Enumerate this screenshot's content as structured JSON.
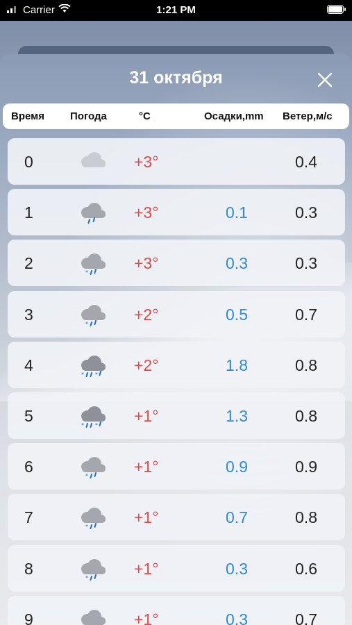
{
  "status_bar": {
    "carrier": "Carrier",
    "time": "1:21 PM",
    "icons": [
      "wifi-icon",
      "battery-icon"
    ]
  },
  "header": {
    "title": "31 октября",
    "close_icon": "close-icon"
  },
  "columns": {
    "time": "Время",
    "weather": "Погода",
    "temp": "°C",
    "precip": "Осадки,mm",
    "wind": "Ветер,м/с"
  },
  "colors": {
    "temp": "#e24a47",
    "precip": "#2e8bd6"
  },
  "rows": [
    {
      "hour": "0",
      "icon": "cloud-icon",
      "temp": "+3°",
      "precip": "",
      "wind": "0.4"
    },
    {
      "hour": "1",
      "icon": "cloud-rain-icon",
      "temp": "+3°",
      "precip": "0.1",
      "wind": "0.3"
    },
    {
      "hour": "2",
      "icon": "cloud-sleet-icon",
      "temp": "+3°",
      "precip": "0.3",
      "wind": "0.3"
    },
    {
      "hour": "3",
      "icon": "cloud-sleet-icon",
      "temp": "+2°",
      "precip": "0.5",
      "wind": "0.7"
    },
    {
      "hour": "4",
      "icon": "cloud-heavy-sleet-icon",
      "temp": "+2°",
      "precip": "1.8",
      "wind": "0.8"
    },
    {
      "hour": "5",
      "icon": "cloud-heavy-sleet-icon",
      "temp": "+1°",
      "precip": "1.3",
      "wind": "0.8"
    },
    {
      "hour": "6",
      "icon": "cloud-sleet-icon",
      "temp": "+1°",
      "precip": "0.9",
      "wind": "0.9"
    },
    {
      "hour": "7",
      "icon": "cloud-sleet-icon",
      "temp": "+1°",
      "precip": "0.7",
      "wind": "0.8"
    },
    {
      "hour": "8",
      "icon": "cloud-sleet-icon",
      "temp": "+1°",
      "precip": "0.3",
      "wind": "0.6"
    },
    {
      "hour": "9",
      "icon": "cloud-sleet-icon",
      "temp": "+1°",
      "precip": "0.3",
      "wind": "0.7"
    }
  ]
}
